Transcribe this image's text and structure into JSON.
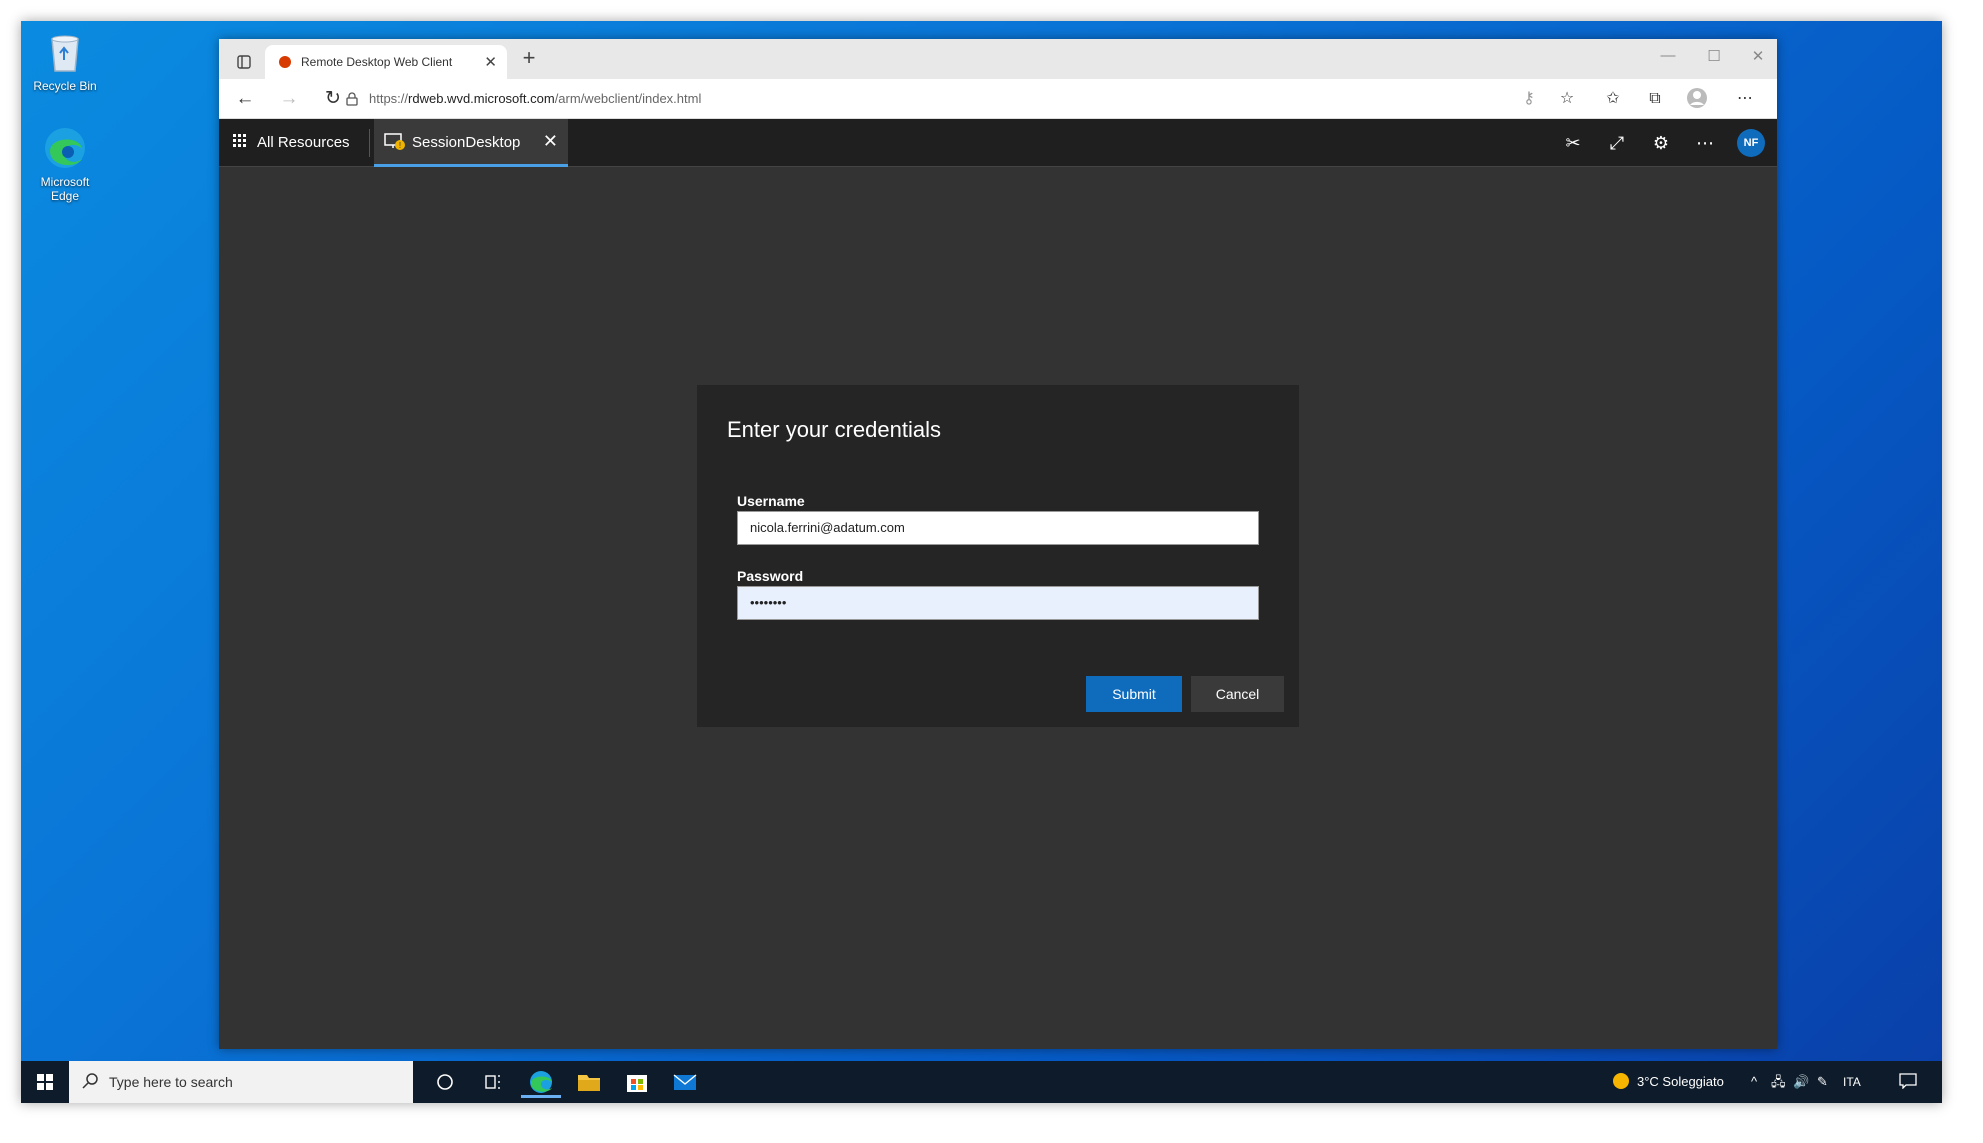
{
  "desktop": {
    "icons": [
      {
        "label": "Recycle Bin"
      },
      {
        "label": "Microsoft Edge"
      }
    ]
  },
  "browser": {
    "tab_title": "Remote Desktop Web Client",
    "url_prefix": "https://",
    "url_host": "rdweb.wvd.microsoft.com",
    "url_path": "/arm/webclient/index.html"
  },
  "rdapp": {
    "all_resources_label": "All Resources",
    "session_tab_label": "SessionDesktop",
    "avatar_initials": "NF"
  },
  "dialog": {
    "title": "Enter your credentials",
    "username_label": "Username",
    "username_value": "nicola.ferrini@adatum.com",
    "password_label": "Password",
    "password_value": "••••••••",
    "submit_label": "Submit",
    "cancel_label": "Cancel"
  },
  "taskbar": {
    "search_placeholder": "Type here to search",
    "weather": "3°C  Soleggiato",
    "language": "ITA"
  },
  "colors": {
    "accent": "#0f6cbd",
    "desktop_blue": "#0a74d6",
    "rd_background": "#333333"
  }
}
